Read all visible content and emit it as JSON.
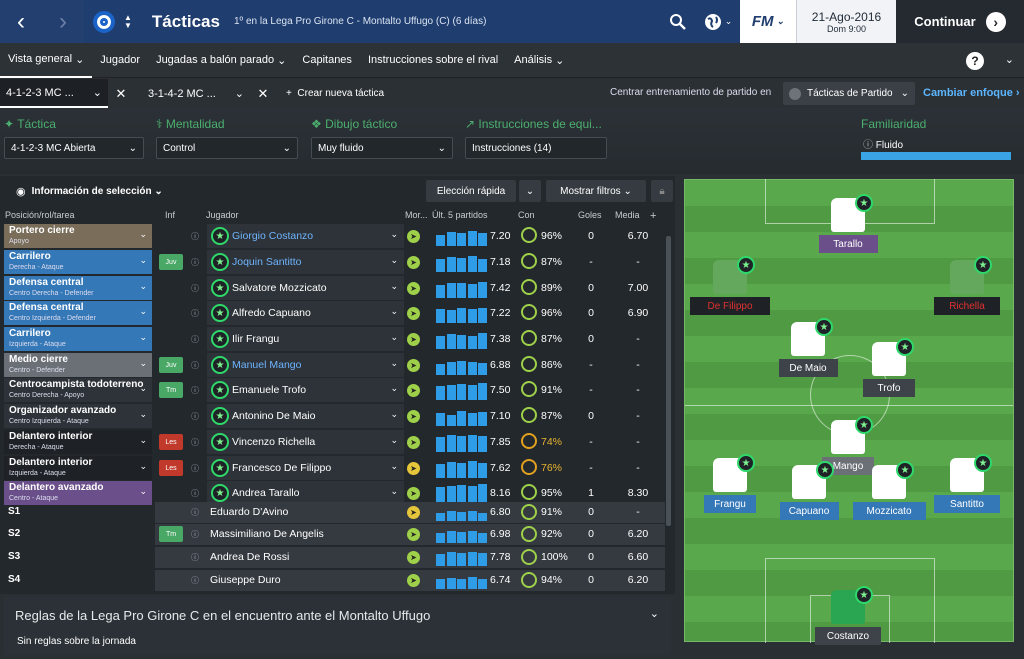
{
  "header": {
    "title": "Tácticas",
    "subtitle": "1º en la Lega Pro Girone C - Montalto Uffugo (C) (6 días)",
    "brand": "FM",
    "date": "21-Ago-2016",
    "time": "Dom 9:00",
    "continue": "Continuar"
  },
  "menu": [
    "Vista general",
    "Jugador",
    "Jugadas a balón parado",
    "Capitanes",
    "Instrucciones sobre el rival",
    "Análisis"
  ],
  "tactic_tabs": {
    "tab1": "4-1-2-3 MC ...",
    "tab2": "3-1-4-2 MC ...",
    "new": "Crear nueva táctica",
    "center_label": "Centrar entrenamiento de partido en",
    "center_value": "Tácticas de Partido",
    "change_focus": "Cambiar enfoque"
  },
  "settings": {
    "tactic_label": "Táctica",
    "tactic_value": "4-1-2-3 MC Abierta",
    "mentality_label": "Mentalidad",
    "mentality_value": "Control",
    "shape_label": "Dibujo táctico",
    "shape_value": "Muy fluido",
    "team_label": "Instrucciones de equi...",
    "team_value": "Instrucciones (14)",
    "familiarity_label": "Familiaridad",
    "familiarity_value": "Fluido",
    "familiarity_fill": 1.0
  },
  "panel": {
    "info": "Información de selección",
    "quick": "Elección rápida",
    "filters": "Mostrar filtros"
  },
  "columns": {
    "pos": "Posición/rol/tarea",
    "inf": "Inf",
    "player": "Jugador",
    "mor": "Mor...",
    "last5": "Últ. 5 partidos",
    "con": "Con",
    "goals": "Goles",
    "avg": "Media"
  },
  "rows": [
    {
      "role": "Portero cierre",
      "detail": "Apoyo",
      "color": "#7a6e5a",
      "badge": "",
      "player": "Giorgio Costanzo",
      "blue": true,
      "mor": "#9ed04a",
      "bars": [
        0.6,
        0.75,
        0.7,
        0.8,
        0.7
      ],
      "rating": "7.20",
      "con": "96%",
      "ring": "#9ed04a",
      "goals": "0",
      "avg": "6.70"
    },
    {
      "role": "Carrilero",
      "detail": "Derecha - Ataque",
      "color": "#3578b8",
      "badge": "Juv",
      "player": "Joquin Santitto",
      "blue": true,
      "mor": "#9ed04a",
      "bars": [
        0.7,
        0.8,
        0.75,
        0.85,
        0.7
      ],
      "rating": "7.18",
      "con": "87%",
      "ring": "#9ed04a",
      "goals": "-",
      "avg": "-"
    },
    {
      "role": "Defensa central",
      "detail": "Centro Derecha - Defender",
      "color": "#3578b8",
      "badge": "",
      "player": "Salvatore Mozzicato",
      "blue": false,
      "mor": "#9ed04a",
      "bars": [
        0.7,
        0.8,
        0.8,
        0.75,
        0.85
      ],
      "rating": "7.42",
      "con": "89%",
      "ring": "#9ed04a",
      "goals": "0",
      "avg": "7.00"
    },
    {
      "role": "Defensa central",
      "detail": "Centro Izquierda - Defender",
      "color": "#3578b8",
      "badge": "",
      "player": "Alfredo Capuano",
      "blue": false,
      "mor": "#9ed04a",
      "bars": [
        0.75,
        0.7,
        0.8,
        0.75,
        0.8
      ],
      "rating": "7.22",
      "con": "96%",
      "ring": "#9ed04a",
      "goals": "0",
      "avg": "6.90"
    },
    {
      "role": "Carrilero",
      "detail": "Izquierda - Ataque",
      "color": "#3578b8",
      "badge": "",
      "player": "Ilir Frangu",
      "blue": false,
      "mor": "#9ed04a",
      "bars": [
        0.7,
        0.8,
        0.75,
        0.7,
        0.85
      ],
      "rating": "7.38",
      "con": "87%",
      "ring": "#9ed04a",
      "goals": "0",
      "avg": "-"
    },
    {
      "role": "Medio cierre",
      "detail": "Centro - Defender",
      "color": "#6b7077",
      "badge": "Juv",
      "player": "Manuel Mango",
      "blue": true,
      "mor": "#9ed04a",
      "bars": [
        0.6,
        0.7,
        0.75,
        0.7,
        0.65
      ],
      "rating": "6.88",
      "con": "86%",
      "ring": "#9ed04a",
      "goals": "-",
      "avg": "-"
    },
    {
      "role": "Centrocampista todoterreno",
      "detail": "Centro Derecha - Apoyo",
      "color": "#2d3338",
      "badge": "Tm",
      "player": "Emanuele Trofo",
      "blue": false,
      "mor": "#9ed04a",
      "bars": [
        0.75,
        0.8,
        0.85,
        0.8,
        0.9
      ],
      "rating": "7.50",
      "con": "91%",
      "ring": "#9ed04a",
      "goals": "-",
      "avg": "-"
    },
    {
      "role": "Organizador avanzado",
      "detail": "Centro Izquierda - Ataque",
      "color": "#2d3338",
      "badge": "",
      "player": "Antonino De Maio",
      "blue": false,
      "mor": "#9ed04a",
      "bars": [
        0.7,
        0.6,
        0.8,
        0.7,
        0.75
      ],
      "rating": "7.10",
      "con": "87%",
      "ring": "#9ed04a",
      "goals": "0",
      "avg": "-"
    },
    {
      "role": "Delantero interior",
      "detail": "Derecha - Ataque",
      "color": "#1e2226",
      "badge": "Les",
      "player": "Vincenzo Richella",
      "blue": false,
      "mor": "#9ed04a",
      "bars": [
        0.8,
        0.9,
        0.85,
        0.9,
        0.85
      ],
      "rating": "7.85",
      "con": "74%",
      "ring": "#e0a020",
      "goals": "-",
      "avg": "-"
    },
    {
      "role": "Delantero interior",
      "detail": "Izquierda - Ataque",
      "color": "#1e2226",
      "badge": "Les",
      "player": "Francesco De Filippo",
      "blue": false,
      "mor": "#e5c53a",
      "bars": [
        0.75,
        0.85,
        0.8,
        0.9,
        0.8
      ],
      "rating": "7.62",
      "con": "76%",
      "ring": "#e0a020",
      "goals": "-",
      "avg": "-"
    },
    {
      "role": "Delantero avanzado",
      "detail": "Centro - Ataque",
      "color": "#6a4f8a",
      "badge": "",
      "player": "Andrea Tarallo",
      "blue": false,
      "mor": "#9ed04a",
      "bars": [
        0.85,
        0.9,
        0.95,
        0.9,
        1.0
      ],
      "rating": "8.16",
      "con": "95%",
      "ring": "#9ed04a",
      "goals": "1",
      "avg": "8.30"
    }
  ],
  "subs": [
    {
      "slot": "S1",
      "badge": "",
      "player": "Eduardo D'Avino",
      "mor": "#e5c53a",
      "bars": [
        0.5,
        0.6,
        0.55,
        0.6,
        0.5
      ],
      "rating": "6.80",
      "con": "91%",
      "ring": "#9ed04a",
      "goals": "0",
      "avg": "-"
    },
    {
      "slot": "S2",
      "badge": "Tm",
      "player": "Massimiliano De Angelis",
      "mor": "#9ed04a",
      "bars": [
        0.6,
        0.7,
        0.65,
        0.7,
        0.6
      ],
      "rating": "6.98",
      "con": "92%",
      "ring": "#9ed04a",
      "goals": "0",
      "avg": "6.20"
    },
    {
      "slot": "S3",
      "badge": "",
      "player": "Andrea De Rossi",
      "mor": "#9ed04a",
      "bars": [
        0.7,
        0.8,
        0.75,
        0.85,
        0.75
      ],
      "rating": "7.78",
      "con": "100%",
      "ring": "#9ed04a",
      "goals": "0",
      "avg": "6.60"
    },
    {
      "slot": "S4",
      "badge": "",
      "player": "Giuseppe Duro",
      "mor": "#9ed04a",
      "bars": [
        0.6,
        0.65,
        0.6,
        0.7,
        0.6
      ],
      "rating": "6.74",
      "con": "94%",
      "ring": "#9ed04a",
      "goals": "0",
      "avg": "6.20"
    }
  ],
  "rules": {
    "title": "Reglas de la Lega Pro Girone C en el encuentro ante el Montalto Uffugo",
    "text": "Sin reglas sobre la jornada"
  },
  "pitch": [
    {
      "name": "Tarallo",
      "style": "white",
      "label_bg": "#6a4f8a"
    },
    {
      "name": "De Filippo",
      "style": "green",
      "label_bg": "#1e2226",
      "label_color": "#e03030"
    },
    {
      "name": "Richella",
      "style": "green",
      "label_bg": "#1e2226",
      "label_color": "#e03030"
    },
    {
      "name": "De Maio",
      "style": "white",
      "label_bg": "#3d4349"
    },
    {
      "name": "Trofo",
      "style": "white",
      "label_bg": "#3d4349"
    },
    {
      "name": "Mango",
      "style": "white",
      "label_bg": "#6b7077"
    },
    {
      "name": "Frangu",
      "style": "white",
      "label_bg": "#3578b8"
    },
    {
      "name": "Capuano",
      "style": "white",
      "label_bg": "#3578b8"
    },
    {
      "name": "Mozzicato",
      "style": "white",
      "label_bg": "#3578b8"
    },
    {
      "name": "Santitto",
      "style": "white",
      "label_bg": "#3578b8"
    },
    {
      "name": "Costanzo",
      "style": "gk",
      "label_bg": "#3d4349"
    }
  ]
}
